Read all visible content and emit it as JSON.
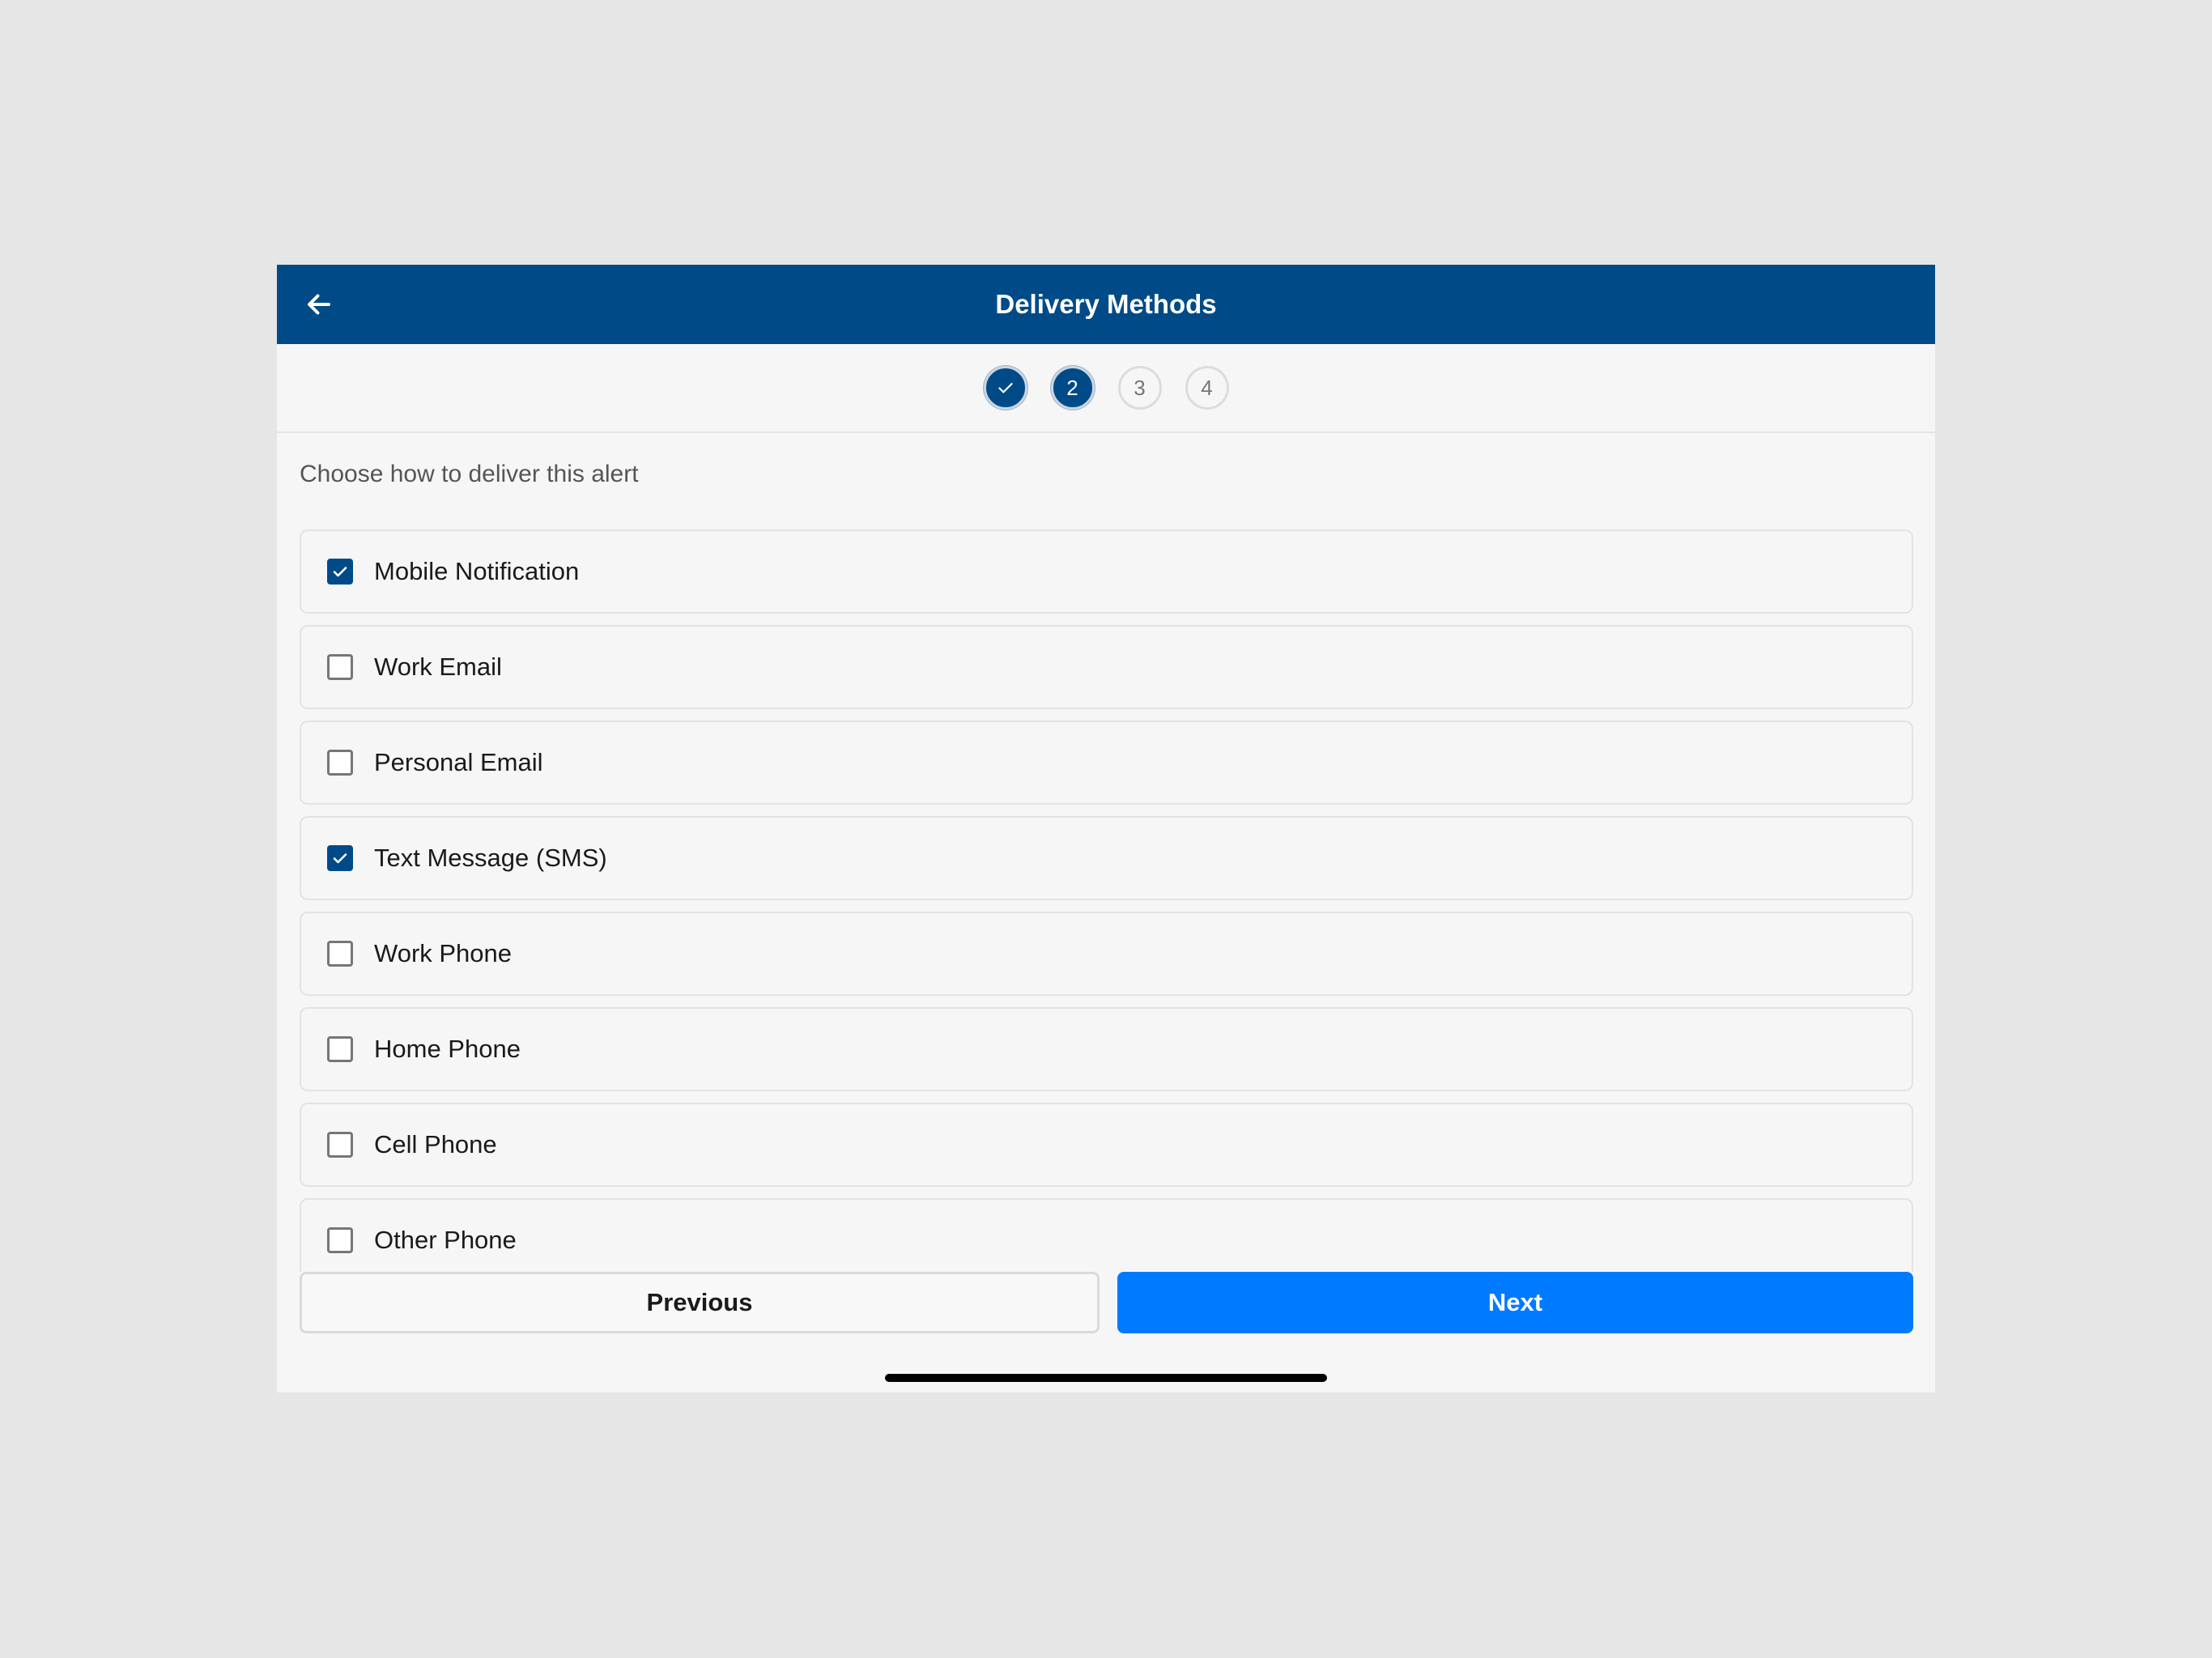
{
  "header": {
    "title": "Delivery Methods",
    "back_icon": "arrow-left-icon",
    "color": "#004b87"
  },
  "stepper": {
    "current_step": 2,
    "steps": [
      {
        "label": "",
        "state": "completed",
        "icon": "check-icon"
      },
      {
        "label": "2",
        "state": "current"
      },
      {
        "label": "3",
        "state": "pending"
      },
      {
        "label": "4",
        "state": "pending"
      }
    ]
  },
  "main": {
    "instructions": "Choose how to deliver this alert",
    "options": [
      {
        "label": "Mobile Notification",
        "checked": true
      },
      {
        "label": "Work Email",
        "checked": false
      },
      {
        "label": "Personal Email",
        "checked": false
      },
      {
        "label": "Text Message (SMS)",
        "checked": true
      },
      {
        "label": "Work Phone",
        "checked": false
      },
      {
        "label": "Home Phone",
        "checked": false
      },
      {
        "label": "Cell Phone",
        "checked": false
      },
      {
        "label": "Other Phone",
        "checked": false
      }
    ]
  },
  "footer": {
    "previous_label": "Previous",
    "next_label": "Next",
    "next_color": "#007aff"
  }
}
